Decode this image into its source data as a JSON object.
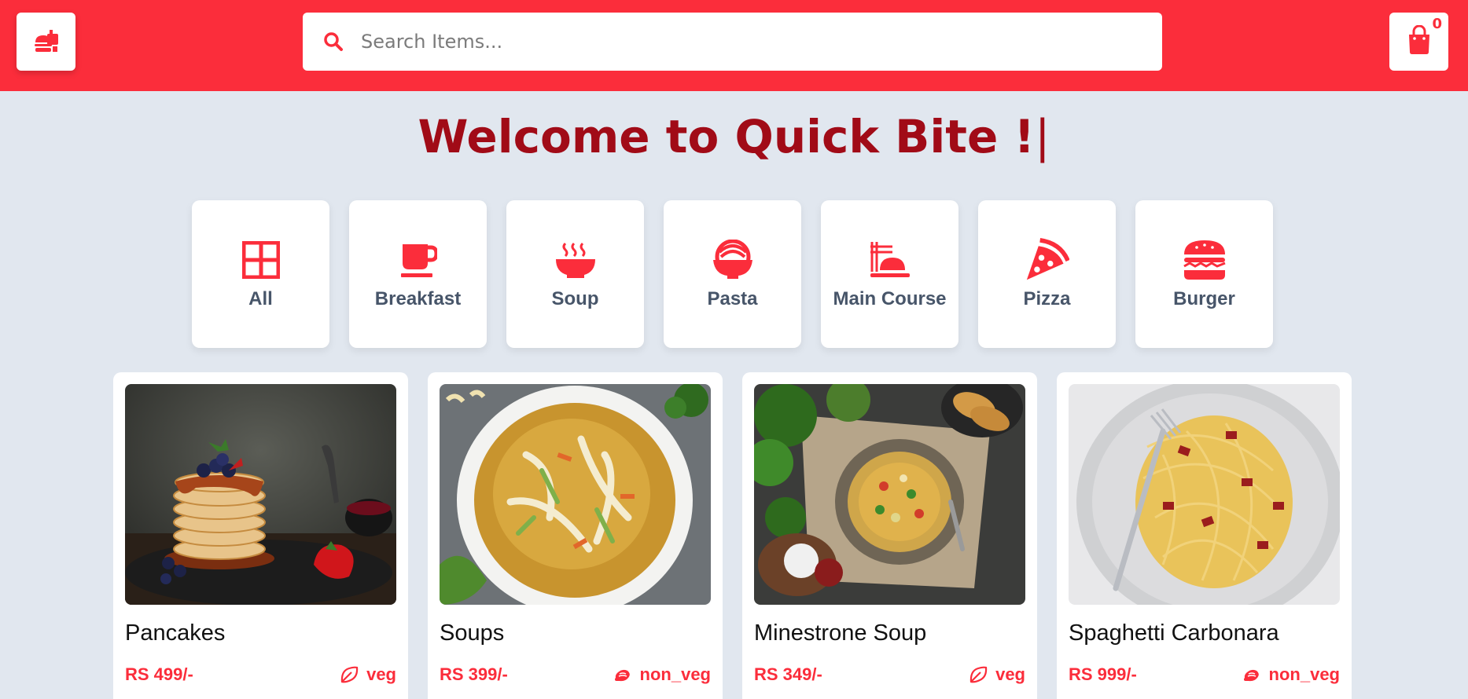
{
  "colors": {
    "brand": "#fb2d3b",
    "title": "#a10b17",
    "background": "#e1e7ef",
    "category_label": "#475569"
  },
  "header": {
    "logo_icon": "burger-drink-icon",
    "search": {
      "placeholder": "Search Items...",
      "value": "",
      "icon": "search-icon"
    },
    "cart": {
      "icon": "shopping-bag-icon",
      "count": "0"
    }
  },
  "welcome": {
    "text": "Welcome to Quick Bite !",
    "cursor": "|"
  },
  "categories": [
    {
      "label": "All",
      "icon": "grid-icon"
    },
    {
      "label": "Breakfast",
      "icon": "mug-icon"
    },
    {
      "label": "Soup",
      "icon": "bowl-steam-icon"
    },
    {
      "label": "Pasta",
      "icon": "bowl-rice-icon"
    },
    {
      "label": "Main Course",
      "icon": "noodles-icon"
    },
    {
      "label": "Pizza",
      "icon": "pizza-slice-icon"
    },
    {
      "label": "Burger",
      "icon": "burger-icon"
    }
  ],
  "products": [
    {
      "name": "Pancakes",
      "price": "RS 499/-",
      "type": "veg",
      "type_icon": "leaf-icon"
    },
    {
      "name": "Soups",
      "price": "RS 399/-",
      "type": "non_veg",
      "type_icon": "drumstick-icon"
    },
    {
      "name": "Minestrone Soup",
      "price": "RS 349/-",
      "type": "veg",
      "type_icon": "leaf-icon"
    },
    {
      "name": "Spaghetti Carbonara",
      "price": "RS 999/-",
      "type": "non_veg",
      "type_icon": "drumstick-icon"
    }
  ]
}
